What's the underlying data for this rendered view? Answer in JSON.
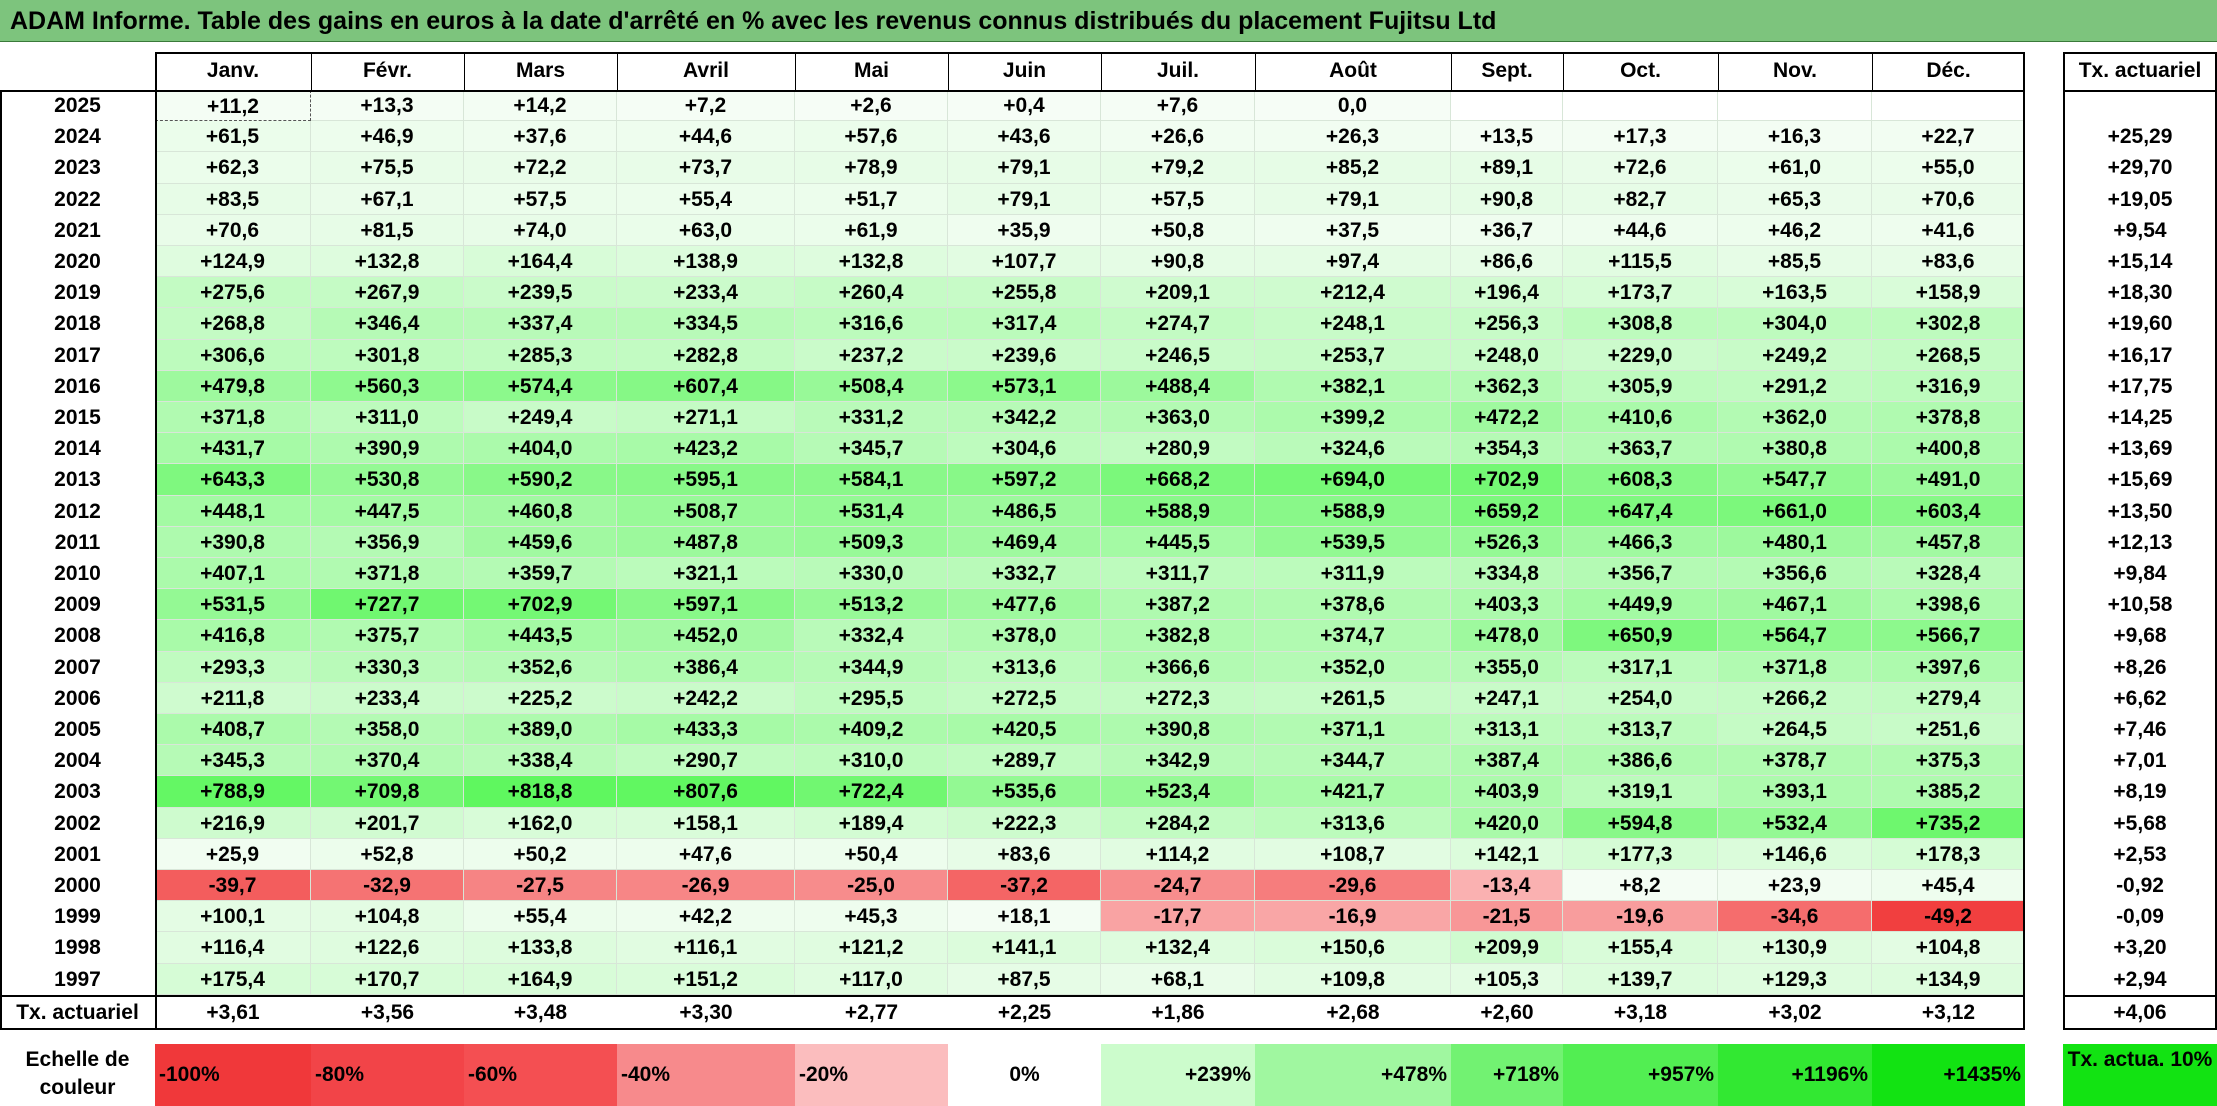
{
  "title": "ADAM Informe. Table des gains en euros à la date d'arrêté en % avec les revenus connus distribués du placement Fujitsu Ltd",
  "chart_data": {
    "type": "heatmap",
    "title": "ADAM Informe. Table des gains en euros à la date d'arrêté en % avec les revenus connus distribués du placement Fujitsu Ltd",
    "columns": [
      "Janv.",
      "Févr.",
      "Mars",
      "Avril",
      "Mai",
      "Juin",
      "Juil.",
      "Août",
      "Sept.",
      "Oct.",
      "Nov.",
      "Déc."
    ],
    "summary_column_label": "Tx. actuariel",
    "summary_row_label": "Tx. actuariel",
    "rows": [
      {
        "year": "2025",
        "values": [
          "+11,2",
          "+13,3",
          "+14,2",
          "+7,2",
          "+2,6",
          "+0,4",
          "+7,6",
          "0,0",
          "",
          "",
          "",
          ""
        ],
        "tx": ""
      },
      {
        "year": "2024",
        "values": [
          "+61,5",
          "+46,9",
          "+37,6",
          "+44,6",
          "+57,6",
          "+43,6",
          "+26,6",
          "+26,3",
          "+13,5",
          "+17,3",
          "+16,3",
          "+22,7"
        ],
        "tx": "+25,29"
      },
      {
        "year": "2023",
        "values": [
          "+62,3",
          "+75,5",
          "+72,2",
          "+73,7",
          "+78,9",
          "+79,1",
          "+79,2",
          "+85,2",
          "+89,1",
          "+72,6",
          "+61,0",
          "+55,0"
        ],
        "tx": "+29,70"
      },
      {
        "year": "2022",
        "values": [
          "+83,5",
          "+67,1",
          "+57,5",
          "+55,4",
          "+51,7",
          "+79,1",
          "+57,5",
          "+79,1",
          "+90,8",
          "+82,7",
          "+65,3",
          "+70,6"
        ],
        "tx": "+19,05"
      },
      {
        "year": "2021",
        "values": [
          "+70,6",
          "+81,5",
          "+74,0",
          "+63,0",
          "+61,9",
          "+35,9",
          "+50,8",
          "+37,5",
          "+36,7",
          "+44,6",
          "+46,2",
          "+41,6"
        ],
        "tx": "+9,54"
      },
      {
        "year": "2020",
        "values": [
          "+124,9",
          "+132,8",
          "+164,4",
          "+138,9",
          "+132,8",
          "+107,7",
          "+90,8",
          "+97,4",
          "+86,6",
          "+115,5",
          "+85,5",
          "+83,6"
        ],
        "tx": "+15,14"
      },
      {
        "year": "2019",
        "values": [
          "+275,6",
          "+267,9",
          "+239,5",
          "+233,4",
          "+260,4",
          "+255,8",
          "+209,1",
          "+212,4",
          "+196,4",
          "+173,7",
          "+163,5",
          "+158,9"
        ],
        "tx": "+18,30"
      },
      {
        "year": "2018",
        "values": [
          "+268,8",
          "+346,4",
          "+337,4",
          "+334,5",
          "+316,6",
          "+317,4",
          "+274,7",
          "+248,1",
          "+256,3",
          "+308,8",
          "+304,0",
          "+302,8"
        ],
        "tx": "+19,60"
      },
      {
        "year": "2017",
        "values": [
          "+306,6",
          "+301,8",
          "+285,3",
          "+282,8",
          "+237,2",
          "+239,6",
          "+246,5",
          "+253,7",
          "+248,0",
          "+229,0",
          "+249,2",
          "+268,5"
        ],
        "tx": "+16,17"
      },
      {
        "year": "2016",
        "values": [
          "+479,8",
          "+560,3",
          "+574,4",
          "+607,4",
          "+508,4",
          "+573,1",
          "+488,4",
          "+382,1",
          "+362,3",
          "+305,9",
          "+291,2",
          "+316,9"
        ],
        "tx": "+17,75"
      },
      {
        "year": "2015",
        "values": [
          "+371,8",
          "+311,0",
          "+249,4",
          "+271,1",
          "+331,2",
          "+342,2",
          "+363,0",
          "+399,2",
          "+472,2",
          "+410,6",
          "+362,0",
          "+378,8"
        ],
        "tx": "+14,25"
      },
      {
        "year": "2014",
        "values": [
          "+431,7",
          "+390,9",
          "+404,0",
          "+423,2",
          "+345,7",
          "+304,6",
          "+280,9",
          "+324,6",
          "+354,3",
          "+363,7",
          "+380,8",
          "+400,8"
        ],
        "tx": "+13,69"
      },
      {
        "year": "2013",
        "values": [
          "+643,3",
          "+530,8",
          "+590,2",
          "+595,1",
          "+584,1",
          "+597,2",
          "+668,2",
          "+694,0",
          "+702,9",
          "+608,3",
          "+547,7",
          "+491,0"
        ],
        "tx": "+15,69"
      },
      {
        "year": "2012",
        "values": [
          "+448,1",
          "+447,5",
          "+460,8",
          "+508,7",
          "+531,4",
          "+486,5",
          "+588,9",
          "+588,9",
          "+659,2",
          "+647,4",
          "+661,0",
          "+603,4"
        ],
        "tx": "+13,50"
      },
      {
        "year": "2011",
        "values": [
          "+390,8",
          "+356,9",
          "+459,6",
          "+487,8",
          "+509,3",
          "+469,4",
          "+445,5",
          "+539,5",
          "+526,3",
          "+466,3",
          "+480,1",
          "+457,8"
        ],
        "tx": "+12,13"
      },
      {
        "year": "2010",
        "values": [
          "+407,1",
          "+371,8",
          "+359,7",
          "+321,1",
          "+330,0",
          "+332,7",
          "+311,7",
          "+311,9",
          "+334,8",
          "+356,7",
          "+356,6",
          "+328,4"
        ],
        "tx": "+9,84"
      },
      {
        "year": "2009",
        "values": [
          "+531,5",
          "+727,7",
          "+702,9",
          "+597,1",
          "+513,2",
          "+477,6",
          "+387,2",
          "+378,6",
          "+403,3",
          "+449,9",
          "+467,1",
          "+398,6"
        ],
        "tx": "+10,58"
      },
      {
        "year": "2008",
        "values": [
          "+416,8",
          "+375,7",
          "+443,5",
          "+452,0",
          "+332,4",
          "+378,0",
          "+382,8",
          "+374,7",
          "+478,0",
          "+650,9",
          "+564,7",
          "+566,7"
        ],
        "tx": "+9,68"
      },
      {
        "year": "2007",
        "values": [
          "+293,3",
          "+330,3",
          "+352,6",
          "+386,4",
          "+344,9",
          "+313,6",
          "+366,6",
          "+352,0",
          "+355,0",
          "+317,1",
          "+371,8",
          "+397,6"
        ],
        "tx": "+8,26"
      },
      {
        "year": "2006",
        "values": [
          "+211,8",
          "+233,4",
          "+225,2",
          "+242,2",
          "+295,5",
          "+272,5",
          "+272,3",
          "+261,5",
          "+247,1",
          "+254,0",
          "+266,2",
          "+279,4"
        ],
        "tx": "+6,62"
      },
      {
        "year": "2005",
        "values": [
          "+408,7",
          "+358,0",
          "+389,0",
          "+433,3",
          "+409,2",
          "+420,5",
          "+390,8",
          "+371,1",
          "+313,1",
          "+313,7",
          "+264,5",
          "+251,6"
        ],
        "tx": "+7,46"
      },
      {
        "year": "2004",
        "values": [
          "+345,3",
          "+370,4",
          "+338,4",
          "+290,7",
          "+310,0",
          "+289,7",
          "+342,9",
          "+344,7",
          "+387,4",
          "+386,6",
          "+378,7",
          "+375,3"
        ],
        "tx": "+7,01"
      },
      {
        "year": "2003",
        "values": [
          "+788,9",
          "+709,8",
          "+818,8",
          "+807,6",
          "+722,4",
          "+535,6",
          "+523,4",
          "+421,7",
          "+403,9",
          "+319,1",
          "+393,1",
          "+385,2"
        ],
        "tx": "+8,19"
      },
      {
        "year": "2002",
        "values": [
          "+216,9",
          "+201,7",
          "+162,0",
          "+158,1",
          "+189,4",
          "+222,3",
          "+284,2",
          "+313,6",
          "+420,0",
          "+594,8",
          "+532,4",
          "+735,2"
        ],
        "tx": "+5,68"
      },
      {
        "year": "2001",
        "values": [
          "+25,9",
          "+52,8",
          "+50,2",
          "+47,6",
          "+50,4",
          "+83,6",
          "+114,2",
          "+108,7",
          "+142,1",
          "+177,3",
          "+146,6",
          "+178,3"
        ],
        "tx": "+2,53"
      },
      {
        "year": "2000",
        "values": [
          "-39,7",
          "-32,9",
          "-27,5",
          "-26,9",
          "-25,0",
          "-37,2",
          "-24,7",
          "-29,6",
          "-13,4",
          "+8,2",
          "+23,9",
          "+45,4"
        ],
        "tx": "-0,92"
      },
      {
        "year": "1999",
        "values": [
          "+100,1",
          "+104,8",
          "+55,4",
          "+42,2",
          "+45,3",
          "+18,1",
          "-17,7",
          "-16,9",
          "-21,5",
          "-19,6",
          "-34,6",
          "-49,2"
        ],
        "tx": "-0,09"
      },
      {
        "year": "1998",
        "values": [
          "+116,4",
          "+122,6",
          "+133,8",
          "+116,1",
          "+121,2",
          "+141,1",
          "+132,4",
          "+150,6",
          "+209,9",
          "+155,4",
          "+130,9",
          "+104,8"
        ],
        "tx": "+3,20"
      },
      {
        "year": "1997",
        "values": [
          "+175,4",
          "+170,7",
          "+164,9",
          "+151,2",
          "+117,0",
          "+87,5",
          "+68,1",
          "+109,8",
          "+105,3",
          "+139,7",
          "+129,3",
          "+134,9"
        ],
        "tx": "+2,94"
      }
    ],
    "tx_row": [
      "+3,61",
      "+3,56",
      "+3,48",
      "+3,30",
      "+2,77",
      "+2,25",
      "+1,86",
      "+2,68",
      "+2,60",
      "+3,18",
      "+3,02",
      "+3,12"
    ],
    "tx_total": "+4,06",
    "scale_label": "Echelle de couleur",
    "scale": [
      {
        "label": "-100%",
        "color": "#f0383a"
      },
      {
        "label": "-80%",
        "color": "#f24448"
      },
      {
        "label": "-60%",
        "color": "#f44f52"
      },
      {
        "label": "-40%",
        "color": "#f78a8c"
      },
      {
        "label": "-20%",
        "color": "#fbbdbe"
      },
      {
        "label": "0%",
        "color": "#ffffff"
      },
      {
        "label": "+239%",
        "color": "#ccfccc"
      },
      {
        "label": "+478%",
        "color": "#a0f7a0"
      },
      {
        "label": "+718%",
        "color": "#72f272"
      },
      {
        "label": "+957%",
        "color": "#52ee52"
      },
      {
        "label": "+1196%",
        "color": "#32e832"
      },
      {
        "label": "+1435%",
        "color": "#12e312"
      }
    ],
    "scale_tx_label": "Tx. actua. 10%",
    "scale_tx_color": "#12e312",
    "colors": {
      "title_bar": "#7dc47d",
      "neg_max": "#f0383a",
      "pos_max": "#12e312",
      "neutral": "#ffffff"
    }
  }
}
